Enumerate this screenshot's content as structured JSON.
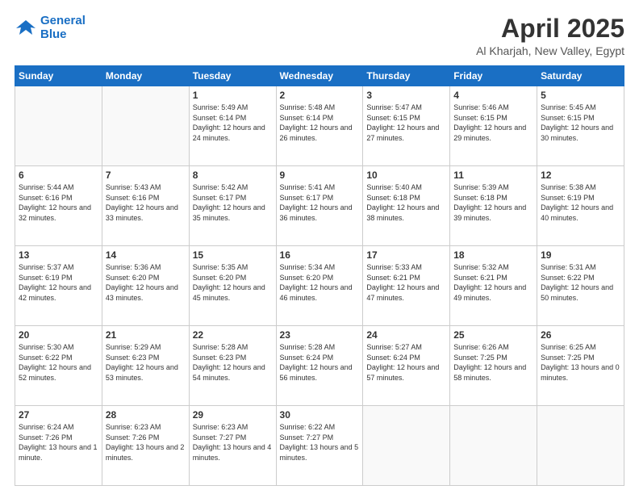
{
  "logo": {
    "line1": "General",
    "line2": "Blue"
  },
  "title": "April 2025",
  "subtitle": "Al Kharjah, New Valley, Egypt",
  "days_of_week": [
    "Sunday",
    "Monday",
    "Tuesday",
    "Wednesday",
    "Thursday",
    "Friday",
    "Saturday"
  ],
  "weeks": [
    [
      {
        "num": "",
        "info": ""
      },
      {
        "num": "",
        "info": ""
      },
      {
        "num": "1",
        "info": "Sunrise: 5:49 AM\nSunset: 6:14 PM\nDaylight: 12 hours and 24 minutes."
      },
      {
        "num": "2",
        "info": "Sunrise: 5:48 AM\nSunset: 6:14 PM\nDaylight: 12 hours and 26 minutes."
      },
      {
        "num": "3",
        "info": "Sunrise: 5:47 AM\nSunset: 6:15 PM\nDaylight: 12 hours and 27 minutes."
      },
      {
        "num": "4",
        "info": "Sunrise: 5:46 AM\nSunset: 6:15 PM\nDaylight: 12 hours and 29 minutes."
      },
      {
        "num": "5",
        "info": "Sunrise: 5:45 AM\nSunset: 6:15 PM\nDaylight: 12 hours and 30 minutes."
      }
    ],
    [
      {
        "num": "6",
        "info": "Sunrise: 5:44 AM\nSunset: 6:16 PM\nDaylight: 12 hours and 32 minutes."
      },
      {
        "num": "7",
        "info": "Sunrise: 5:43 AM\nSunset: 6:16 PM\nDaylight: 12 hours and 33 minutes."
      },
      {
        "num": "8",
        "info": "Sunrise: 5:42 AM\nSunset: 6:17 PM\nDaylight: 12 hours and 35 minutes."
      },
      {
        "num": "9",
        "info": "Sunrise: 5:41 AM\nSunset: 6:17 PM\nDaylight: 12 hours and 36 minutes."
      },
      {
        "num": "10",
        "info": "Sunrise: 5:40 AM\nSunset: 6:18 PM\nDaylight: 12 hours and 38 minutes."
      },
      {
        "num": "11",
        "info": "Sunrise: 5:39 AM\nSunset: 6:18 PM\nDaylight: 12 hours and 39 minutes."
      },
      {
        "num": "12",
        "info": "Sunrise: 5:38 AM\nSunset: 6:19 PM\nDaylight: 12 hours and 40 minutes."
      }
    ],
    [
      {
        "num": "13",
        "info": "Sunrise: 5:37 AM\nSunset: 6:19 PM\nDaylight: 12 hours and 42 minutes."
      },
      {
        "num": "14",
        "info": "Sunrise: 5:36 AM\nSunset: 6:20 PM\nDaylight: 12 hours and 43 minutes."
      },
      {
        "num": "15",
        "info": "Sunrise: 5:35 AM\nSunset: 6:20 PM\nDaylight: 12 hours and 45 minutes."
      },
      {
        "num": "16",
        "info": "Sunrise: 5:34 AM\nSunset: 6:20 PM\nDaylight: 12 hours and 46 minutes."
      },
      {
        "num": "17",
        "info": "Sunrise: 5:33 AM\nSunset: 6:21 PM\nDaylight: 12 hours and 47 minutes."
      },
      {
        "num": "18",
        "info": "Sunrise: 5:32 AM\nSunset: 6:21 PM\nDaylight: 12 hours and 49 minutes."
      },
      {
        "num": "19",
        "info": "Sunrise: 5:31 AM\nSunset: 6:22 PM\nDaylight: 12 hours and 50 minutes."
      }
    ],
    [
      {
        "num": "20",
        "info": "Sunrise: 5:30 AM\nSunset: 6:22 PM\nDaylight: 12 hours and 52 minutes."
      },
      {
        "num": "21",
        "info": "Sunrise: 5:29 AM\nSunset: 6:23 PM\nDaylight: 12 hours and 53 minutes."
      },
      {
        "num": "22",
        "info": "Sunrise: 5:28 AM\nSunset: 6:23 PM\nDaylight: 12 hours and 54 minutes."
      },
      {
        "num": "23",
        "info": "Sunrise: 5:28 AM\nSunset: 6:24 PM\nDaylight: 12 hours and 56 minutes."
      },
      {
        "num": "24",
        "info": "Sunrise: 5:27 AM\nSunset: 6:24 PM\nDaylight: 12 hours and 57 minutes."
      },
      {
        "num": "25",
        "info": "Sunrise: 6:26 AM\nSunset: 7:25 PM\nDaylight: 12 hours and 58 minutes."
      },
      {
        "num": "26",
        "info": "Sunrise: 6:25 AM\nSunset: 7:25 PM\nDaylight: 13 hours and 0 minutes."
      }
    ],
    [
      {
        "num": "27",
        "info": "Sunrise: 6:24 AM\nSunset: 7:26 PM\nDaylight: 13 hours and 1 minute."
      },
      {
        "num": "28",
        "info": "Sunrise: 6:23 AM\nSunset: 7:26 PM\nDaylight: 13 hours and 2 minutes."
      },
      {
        "num": "29",
        "info": "Sunrise: 6:23 AM\nSunset: 7:27 PM\nDaylight: 13 hours and 4 minutes."
      },
      {
        "num": "30",
        "info": "Sunrise: 6:22 AM\nSunset: 7:27 PM\nDaylight: 13 hours and 5 minutes."
      },
      {
        "num": "",
        "info": ""
      },
      {
        "num": "",
        "info": ""
      },
      {
        "num": "",
        "info": ""
      }
    ]
  ]
}
